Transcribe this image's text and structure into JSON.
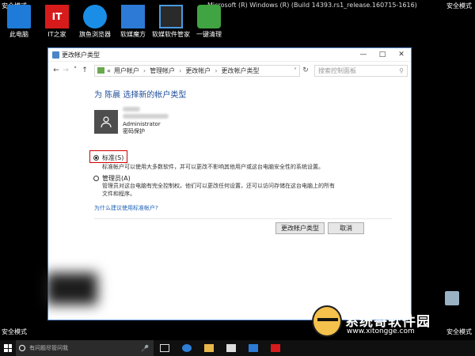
{
  "overlay": {
    "safe_mode": "安全模式",
    "build": "Microsoft (R) Windows (R) (Build 14393.rs1_release.160715-1616)"
  },
  "desktop_icons": [
    {
      "label": "此电脑",
      "glyph": "",
      "icon": "pc-icon"
    },
    {
      "label": "IT之家",
      "glyph": "IT",
      "icon": "ithome-icon"
    },
    {
      "label": "旗鱼浏览器",
      "glyph": "",
      "icon": "flag-browser-icon"
    },
    {
      "label": "软媒魔方",
      "glyph": "",
      "icon": "cube-icon"
    },
    {
      "label": "软媒软件管家",
      "glyph": "",
      "icon": "software-manager-icon"
    },
    {
      "label": "一键清理",
      "glyph": "",
      "icon": "clean-icon"
    }
  ],
  "window": {
    "title": "更改帐户类型",
    "breadcrumb": [
      "«",
      "用户帐户",
      "管理帐户",
      "更改帐户",
      "更改帐户类型"
    ],
    "search_placeholder": "搜索控制面板",
    "heading": "为 陈晨 选择新的帐户类型",
    "user": {
      "role": "Administrator",
      "protection": "密码保护"
    },
    "options": [
      {
        "label": "标准(S)",
        "desc": "标准帐户可以使用大多数软件，并可以更改不影响其他用户或这台电脑安全性的系统设置。",
        "selected": true
      },
      {
        "label": "管理员(A)",
        "desc": "管理员对这台电脑有完全控制权。他们可以更改任何设置，还可以访问存储在这台电脑上的所有文件和程序。",
        "selected": false
      }
    ],
    "help_link": "为什么建议使用标准帐户?",
    "buttons": {
      "change": "更改帐户类型",
      "cancel": "取消"
    }
  },
  "taskbar": {
    "search_text": "有问题尽管问我"
  },
  "logo": {
    "title": "系统哥软件园",
    "url": "www.xitongge.com"
  },
  "colors": {
    "heading": "#1e4e9a",
    "link": "#1a5fb4",
    "highlight": "#d30000"
  }
}
